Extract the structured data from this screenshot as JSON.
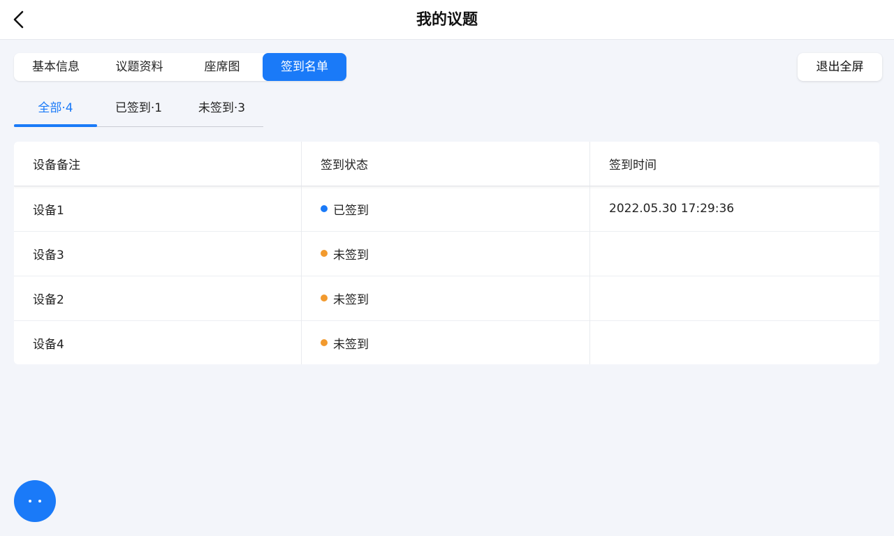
{
  "header": {
    "title": "我的议题",
    "back_icon": "chevron-left-icon"
  },
  "main_tabs": [
    {
      "label": "基本信息",
      "active": false
    },
    {
      "label": "议题资料",
      "active": false
    },
    {
      "label": "座席图",
      "active": false
    },
    {
      "label": "签到名单",
      "active": true
    }
  ],
  "exit_fullscreen_label": "退出全屏",
  "filter_tabs": [
    {
      "label": "全部·4",
      "active": true
    },
    {
      "label": "已签到·1",
      "active": false
    },
    {
      "label": "未签到·3",
      "active": false
    }
  ],
  "table": {
    "columns": [
      "设备备注",
      "签到状态",
      "签到时间"
    ],
    "rows": [
      {
        "device": "设备1",
        "status": "已签到",
        "status_color": "#1a7af8",
        "time": "2022.05.30 17:29:36"
      },
      {
        "device": "设备3",
        "status": "未签到",
        "status_color": "#f29a2e",
        "time": ""
      },
      {
        "device": "设备2",
        "status": "未签到",
        "status_color": "#f29a2e",
        "time": ""
      },
      {
        "device": "设备4",
        "status": "未签到",
        "status_color": "#f29a2e",
        "time": ""
      }
    ]
  },
  "fab_icon": "more-icon",
  "colors": {
    "accent": "#1a7af8",
    "signed": "#1a7af8",
    "unsigned": "#f29a2e",
    "background": "#f3f5fa"
  }
}
